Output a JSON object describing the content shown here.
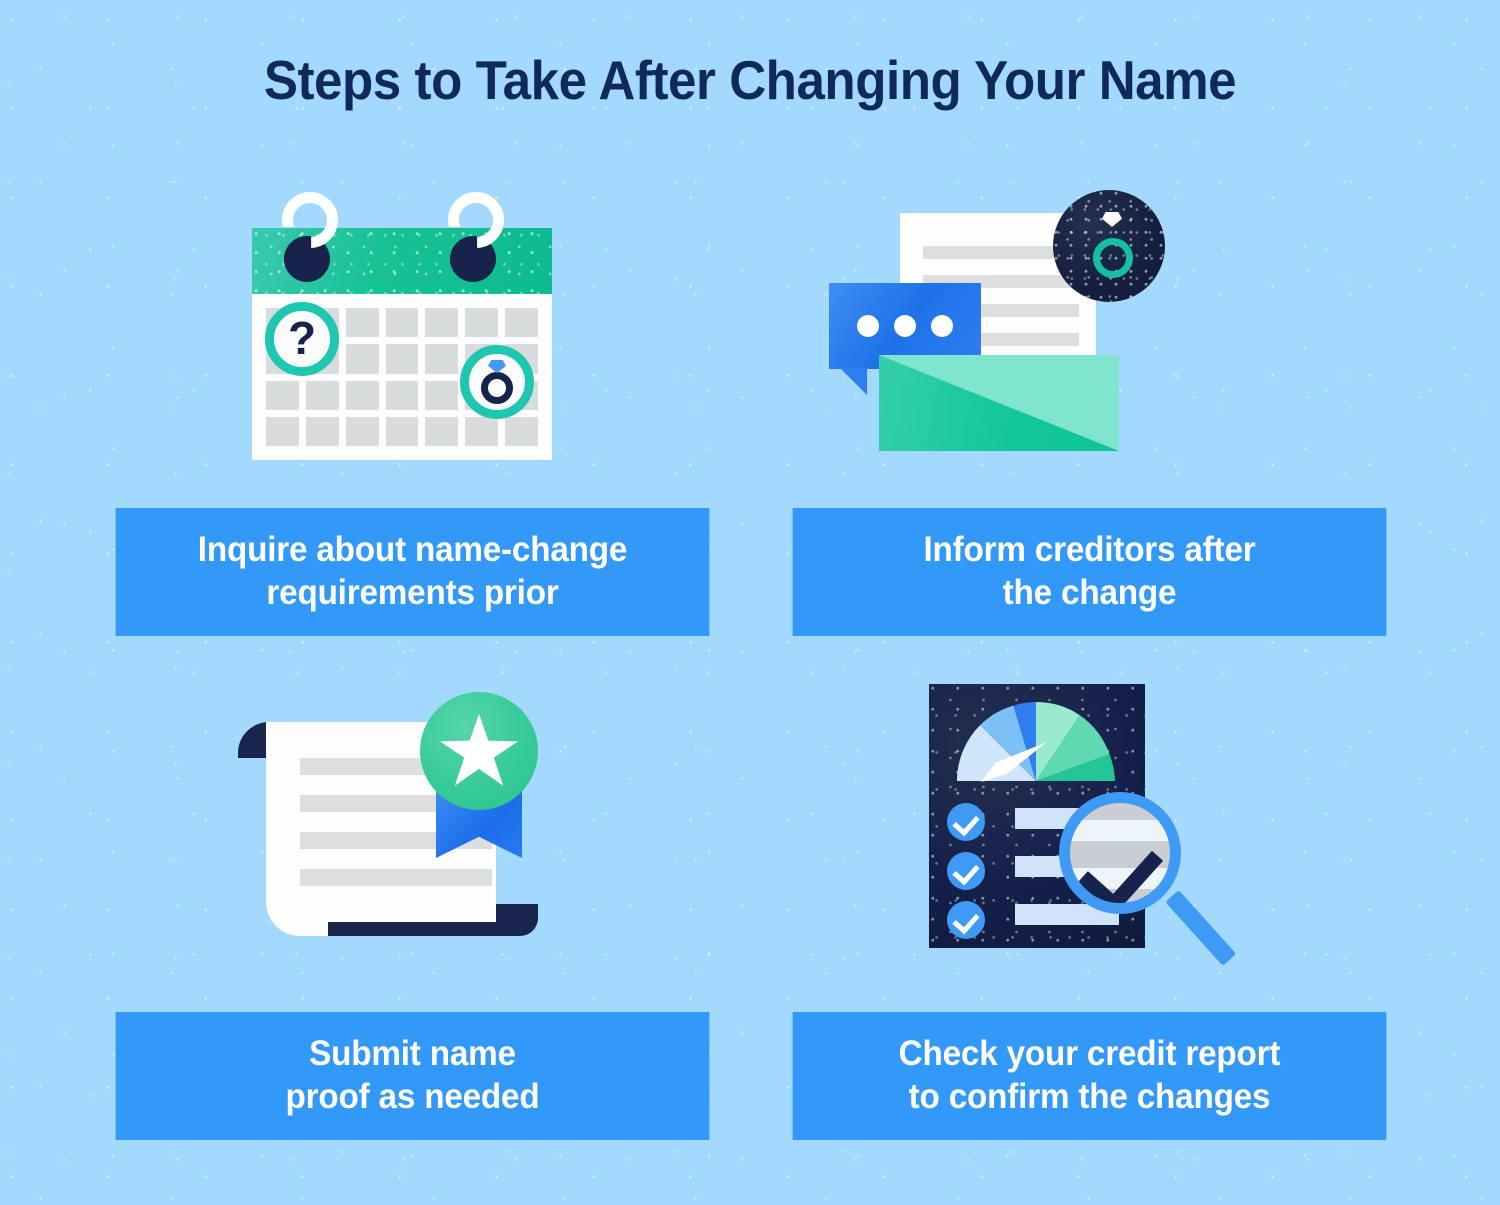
{
  "page": {
    "title": "Steps to Take After Changing Your Name",
    "background_color": "#a3d9fd",
    "title_color": "#10295c",
    "caption_box_color": "#3399f9",
    "caption_text_color": "#ffffff",
    "accent_colors": {
      "teal": "#16c194",
      "blue": "#3399f9",
      "navy": "#16234d",
      "green": "#35c997",
      "gray": "#d9dcdd"
    }
  },
  "steps": [
    {
      "id": "step-1",
      "icon": "calendar-icon",
      "caption_line_1": "Inquire about name-change",
      "caption_line_2": "requirements prior",
      "icon_parts": [
        "calendar-spiral-ring",
        "calendar-header",
        "calendar-grid",
        "question-mark-badge",
        "wedding-ring-badge"
      ]
    },
    {
      "id": "step-2",
      "icon": "letter-notification-icon",
      "caption_line_1": "Inform creditors after",
      "caption_line_2": "the change",
      "icon_parts": [
        "document-sheet",
        "chat-bubble",
        "envelope",
        "ring-seal-badge"
      ]
    },
    {
      "id": "step-3",
      "icon": "certificate-icon",
      "caption_line_1": "Submit name",
      "caption_line_2": "proof as needed",
      "icon_parts": [
        "certificate-scroll",
        "award-medal",
        "ribbon"
      ]
    },
    {
      "id": "step-4",
      "icon": "credit-report-icon",
      "caption_line_1": "Check your credit report",
      "caption_line_2": "to confirm the changes",
      "icon_parts": [
        "credit-score-gauge",
        "checklist",
        "magnifying-glass"
      ]
    }
  ]
}
